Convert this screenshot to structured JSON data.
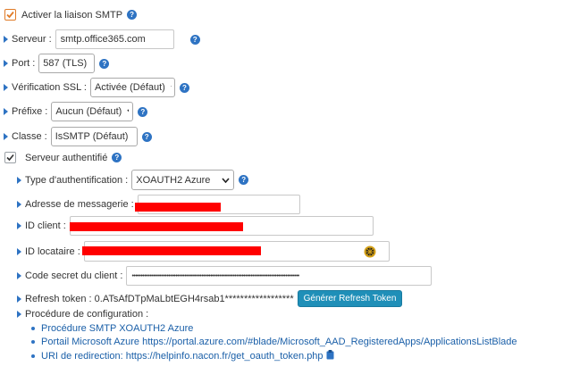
{
  "smtp": {
    "activate_label": "Activer la liaison SMTP",
    "server_label": "Serveur :",
    "server_value": "smtp.office365.com",
    "port_label": "Port :",
    "port_value": "587 (TLS)",
    "ssl_label": "Vérification SSL :",
    "ssl_value": "Activée (Défaut)",
    "prefix_label": "Préfixe :",
    "prefix_value": "Aucun (Défaut)",
    "class_label": "Classe :",
    "class_value": "IsSMTP (Défaut)",
    "auth_server_label": "Serveur authentifié"
  },
  "auth": {
    "type_label": "Type d'authentification :",
    "type_value": "XOAUTH2 Azure",
    "email_label": "Adresse de messagerie :",
    "client_id_label": "ID client :",
    "tenant_id_label": "ID locataire :",
    "secret_label": "Code secret du client :",
    "secret_value": "••••••••••••••••••••••••••••••••••••••••••••••••••••••••••••••••••••••••••••••••••••••••••••••••",
    "refresh_token_text": "Refresh token : 0.ATsAfDTpMaLbtEGH4rsab1******************",
    "refresh_button": "Générer Refresh Token",
    "config_label": "Procédure de configuration :",
    "links": [
      "Procédure SMTP XOAUTH2 Azure",
      "Portail Microsoft Azure https://portal.azure.com/#blade/Microsoft_AAD_RegisteredApps/ApplicationsListBlade",
      "URI de redirection: https://helpinfo.nacon.fr/get_oauth_token.php"
    ]
  },
  "help_glyph": "?",
  "colors": {
    "accent": "#2e73c3",
    "button": "#1f8fb8",
    "redaction": "#ff0000",
    "checkbox_orange": "#e07b27"
  }
}
